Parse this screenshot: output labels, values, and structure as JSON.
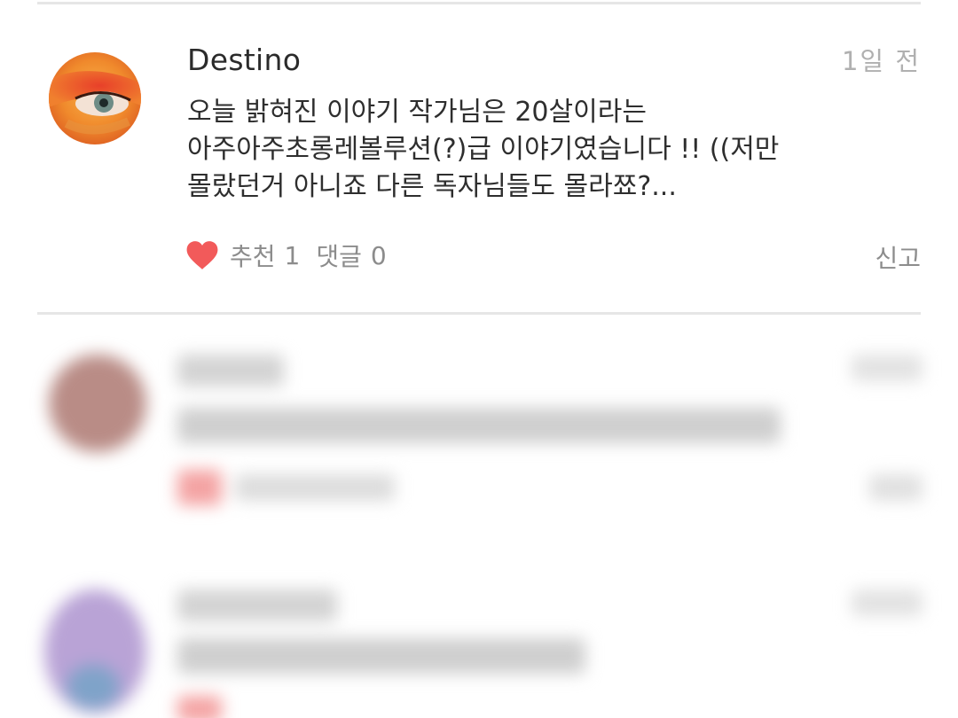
{
  "comment": {
    "author": "Destino",
    "time": "1일 전",
    "text": "오늘 밝혀진 이야기  작가님은 20살이라는\n아주아주초롱레볼루션(?)급 이야기였습니다 !! ((저만\n몰랐던거 아니죠 다른 독자님들도 몰라쬬?...",
    "like_label": "추천",
    "like_count": "1",
    "reply_label": "댓글",
    "reply_count": "0",
    "report_label": "신고"
  },
  "colors": {
    "heart": "#f25a5a",
    "divider": "#e6e6e6",
    "text": "#2e2e2e",
    "muted": "#8c8c8c"
  },
  "icons": [
    "heart-icon"
  ]
}
